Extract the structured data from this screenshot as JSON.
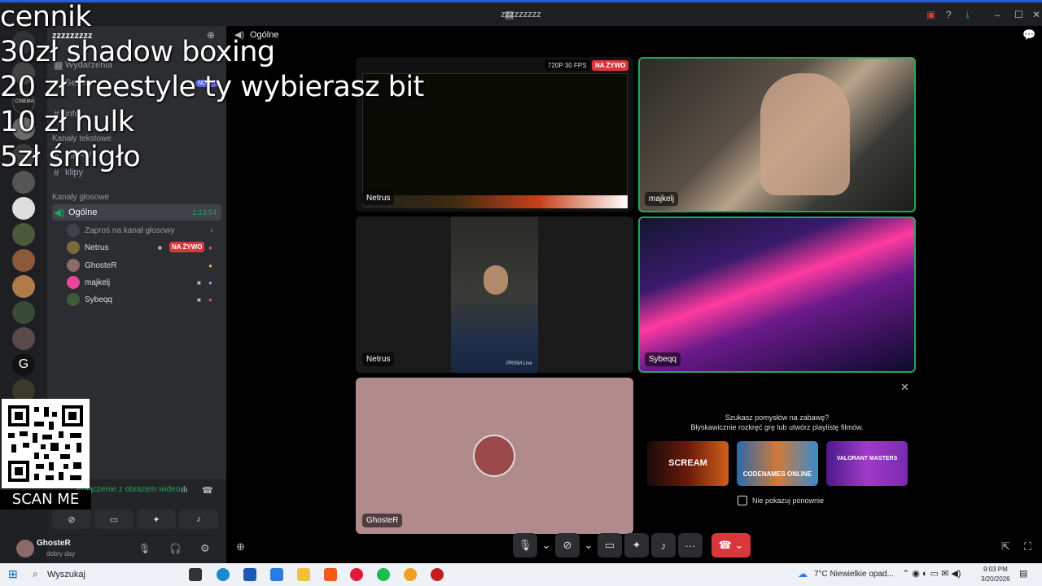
{
  "window": {
    "title": "zzzzzzzzz"
  },
  "server": {
    "name": "zzzzzzzzz",
    "events": "Wydarzenia",
    "new_badge": "NOWE",
    "cinema_label": "CINEMA"
  },
  "channels": {
    "items_top": [
      "Wydarzenia",
      "Serwer",
      "info"
    ],
    "text_section": "Kanały tekstowe",
    "text_items": [
      "ogólny",
      "klipy"
    ],
    "voice_section": "Kanały głosowe",
    "voice_channel": {
      "name": "Ogólne",
      "timer": "1:13:54"
    },
    "invite": "Zaproś na kanał głosowy",
    "members": [
      {
        "name": "Netrus",
        "live": "NA ŻYWO"
      },
      {
        "name": "GhosteR"
      },
      {
        "name": "majkelj"
      },
      {
        "name": "Sybeqq"
      }
    ]
  },
  "voice_panel": {
    "status": "Połączenie z obrazem wideo"
  },
  "user": {
    "name": "GhosteR",
    "status": "dobry day"
  },
  "header": {
    "channel": "Ogólne"
  },
  "tiles": {
    "stream": {
      "name": "Netrus",
      "quality": "720P 30 FPS",
      "live": "NA ŻYWO"
    },
    "majkelj": {
      "name": "majkelj"
    },
    "netrus_cam": {
      "name": "Netrus",
      "watermark": "PRISM Live"
    },
    "sybeqq": {
      "name": "Sybeqq"
    },
    "ghoster": {
      "name": "GhosteR"
    }
  },
  "activities": {
    "title": "Szukasz pomysłów na zabawę?",
    "subtitle": "Błyskawicznie rozkręć grę lub utwórz playlistę filmów.",
    "games": [
      "SCREAM",
      "CODENAMES ONLINE",
      "VALORANT MASTERS"
    ],
    "dont_show": "Nie pokazuj ponownie"
  },
  "overlay": {
    "lines": [
      "cennik",
      "30zł shadow  boxing",
      "20 zł freestyle ty wybierasz bit",
      "10 zł hulk",
      "5zł śmigło"
    ],
    "scan": "SCAN ME"
  },
  "taskbar": {
    "search": "Wyszukaj",
    "weather": "7°C  Niewielkie opad...",
    "time": "9:03 PM",
    "date": "3/20/2026"
  },
  "colors": {
    "accent": "#5865f2",
    "live": "#da373c",
    "speaking": "#23a55a",
    "hangup": "#da373c"
  }
}
